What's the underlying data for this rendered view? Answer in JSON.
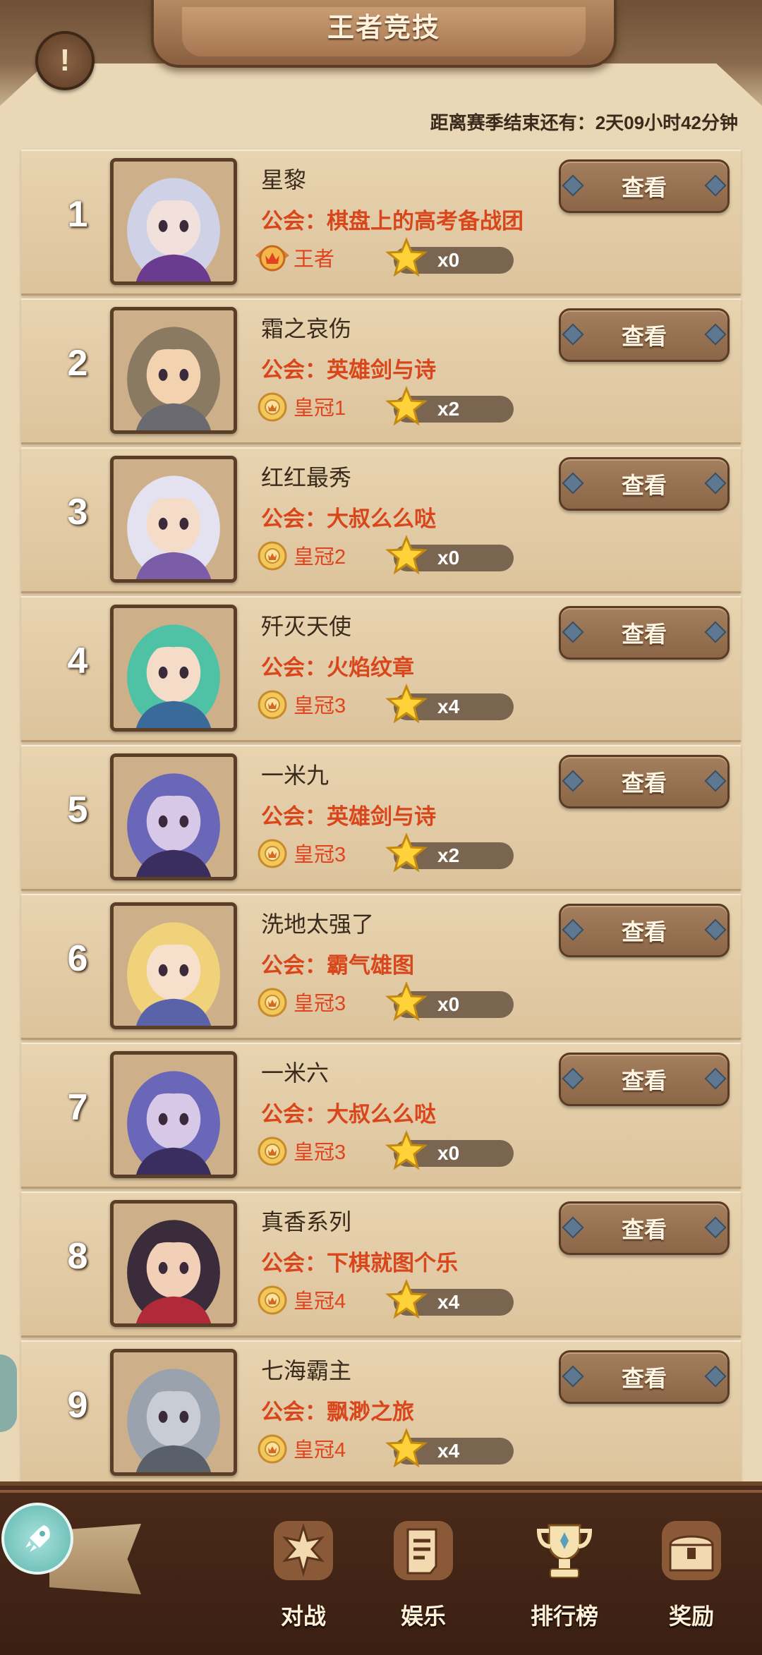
{
  "header": {
    "title": "王者竞技",
    "season_label": "距离赛季结束还有：",
    "season_remaining": "2天09小时42分钟"
  },
  "guild_prefix": "公会：",
  "colors": {
    "guild_text": "#d9461b",
    "tier_text": "#e0441e",
    "name_text": "#3b2b1c",
    "button_bg": "#8b6647",
    "bottom_bar": "#3a1f12"
  },
  "rankings": [
    {
      "rank": "1",
      "name": "星黎",
      "guild": "棋盘上的高考备战团",
      "tier": "王者",
      "stars": "x0",
      "view_label": "查看",
      "avatar_icon": "silver-haired-queen-avatar",
      "hair": "#cfd2e6",
      "skin": "#f1e0dc",
      "accent": "#6b3b8f"
    },
    {
      "rank": "2",
      "name": "霜之哀伤",
      "guild": "英雄剑与诗",
      "tier": "皇冠1",
      "stars": "x2",
      "view_label": "查看",
      "avatar_icon": "hooded-knight-avatar",
      "hair": "#8a7a62",
      "skin": "#f3d2b0",
      "accent": "#6b6a70"
    },
    {
      "rank": "3",
      "name": "红红最秀",
      "guild": "大叔么么哒",
      "tier": "皇冠2",
      "stars": "x0",
      "view_label": "查看",
      "avatar_icon": "white-haired-paladin-avatar",
      "hair": "#e4e2f0",
      "skin": "#f4dcc8",
      "accent": "#7a5ca8"
    },
    {
      "rank": "4",
      "name": "歼灭天使",
      "guild": "火焰纹章",
      "tier": "皇冠3",
      "stars": "x4",
      "view_label": "查看",
      "avatar_icon": "green-haired-visor-avatar",
      "hair": "#4fc2a6",
      "skin": "#f4dcc8",
      "accent": "#3a6a9a"
    },
    {
      "rank": "5",
      "name": "一米九",
      "guild": "英雄剑与诗",
      "tier": "皇冠3",
      "stars": "x2",
      "view_label": "查看",
      "avatar_icon": "dark-elf-avatar",
      "hair": "#6a66b8",
      "skin": "#d8c8e8",
      "accent": "#3a2e5e"
    },
    {
      "rank": "6",
      "name": "洗地太强了",
      "guild": "霸气雄图",
      "tier": "皇冠3",
      "stars": "x0",
      "view_label": "查看",
      "avatar_icon": "blonde-priestess-avatar",
      "hair": "#f0d27a",
      "skin": "#f6e0cc",
      "accent": "#5a62a8"
    },
    {
      "rank": "7",
      "name": "一米六",
      "guild": "大叔么么哒",
      "tier": "皇冠3",
      "stars": "x0",
      "view_label": "查看",
      "avatar_icon": "dark-elf-avatar",
      "hair": "#6a66b8",
      "skin": "#d8c8e8",
      "accent": "#3a2e5e"
    },
    {
      "rank": "8",
      "name": "真香系列",
      "guild": "下棋就图个乐",
      "tier": "皇冠4",
      "stars": "x4",
      "view_label": "查看",
      "avatar_icon": "dark-demon-warrior-avatar",
      "hair": "#3a2c3a",
      "skin": "#f2d0b8",
      "accent": "#b02a3a"
    },
    {
      "rank": "9",
      "name": "七海霸主",
      "guild": "飘渺之旅",
      "tier": "皇冠4",
      "stars": "x4",
      "view_label": "查看",
      "avatar_icon": "silver-dragon-avatar",
      "hair": "#9aa2ae",
      "skin": "#c8ccd4",
      "accent": "#5a606a"
    }
  ],
  "nav": [
    {
      "label": "对战",
      "icon": "battle-icon"
    },
    {
      "label": "娱乐",
      "icon": "scroll-icon"
    },
    {
      "label": "排行榜",
      "icon": "trophy-icon"
    },
    {
      "label": "奖励",
      "icon": "treasure-chest-icon"
    }
  ]
}
